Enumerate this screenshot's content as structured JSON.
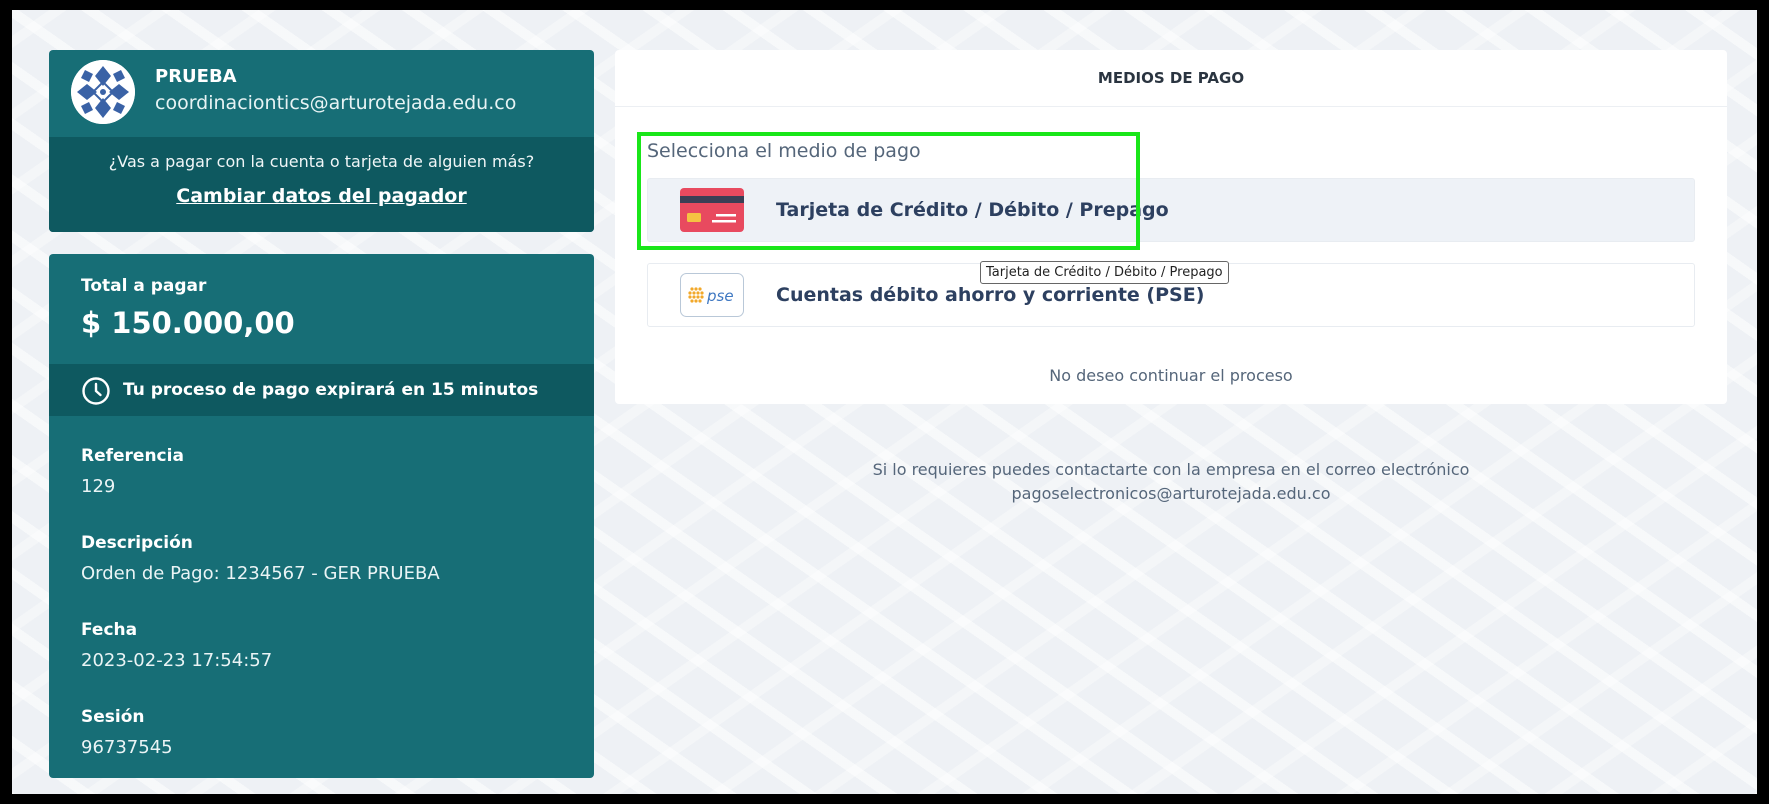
{
  "payer": {
    "name": "PRUEBA",
    "email": "coordinaciontics@arturotejada.edu.co",
    "question": "¿Vas a pagar con la cuenta o tarjeta de alguien más?",
    "change_link": "Cambiar datos del pagador"
  },
  "summary": {
    "total_label": "Total a pagar",
    "total_amount": "$ 150.000,00",
    "timer_text": "Tu proceso de pago expirará en 15 minutos",
    "fields": [
      {
        "label": "Referencia",
        "value": "129"
      },
      {
        "label": "Descripción",
        "value": "Orden de Pago: 1234567 - GER PRUEBA"
      },
      {
        "label": "Fecha",
        "value": "2023-02-23 17:54:57"
      },
      {
        "label": "Sesión",
        "value": "96737545"
      }
    ]
  },
  "methods": {
    "header": "MEDIOS DE PAGO",
    "subtitle": "Selecciona el medio de pago",
    "items": [
      {
        "label": "Tarjeta de Crédito / Débito / Prepago",
        "icon": "credit-card-icon"
      },
      {
        "label": "Cuentas débito ahorro y corriente (PSE)",
        "icon": "pse-logo-icon",
        "icon_text": "pse"
      }
    ],
    "tooltip": "Tarjeta de Crédito / Débito / Prepago",
    "cancel": "No deseo continuar el proceso"
  },
  "contact": {
    "line1": "Si lo requieres puedes contactarte con la empresa en el correo electrónico",
    "line2": "pagoselectronicos@arturotejada.edu.co"
  },
  "colors": {
    "card": "#176e76",
    "card_dark": "#0e5960",
    "highlight": "#19e619",
    "card_red": "#e84a5f"
  }
}
